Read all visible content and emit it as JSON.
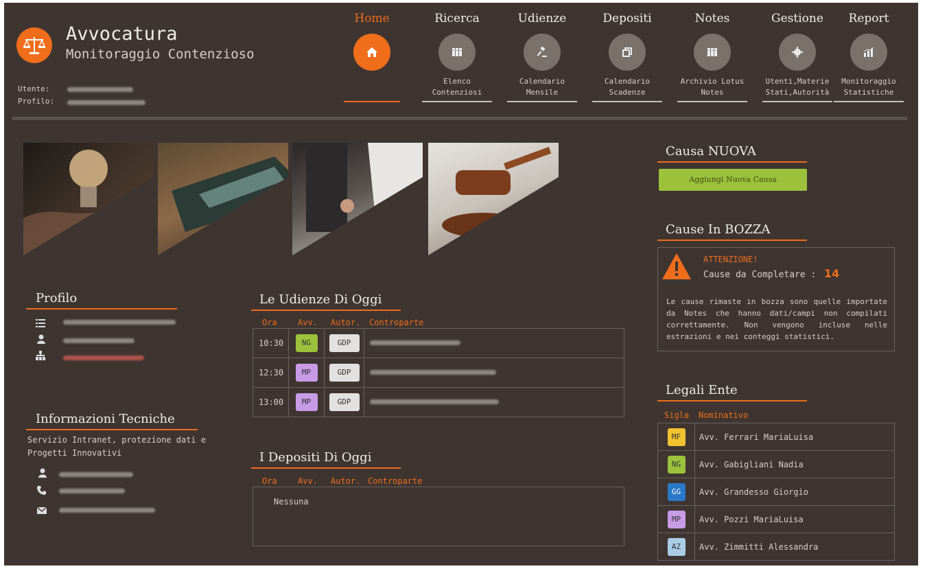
{
  "app": {
    "title": "Avvocatura",
    "subtitle": "Monitoraggio Contenzioso",
    "user_label": "Utente:",
    "profile_label": "Profilo:"
  },
  "colors": {
    "accent": "#f06d1c",
    "background": "#3e3531",
    "green": "#9cc13b"
  },
  "nav": [
    {
      "label": "Home",
      "icon": "home-icon",
      "sub": "",
      "active": true
    },
    {
      "label": "Ricerca",
      "icon": "archive-icon",
      "sub": "Elenco Contenziosi"
    },
    {
      "label": "Udienze",
      "icon": "gavel-icon",
      "sub": "Calendario Mensile"
    },
    {
      "label": "Depositi",
      "icon": "copy-icon",
      "sub": "Calendario Scadenze"
    },
    {
      "label": "Notes",
      "icon": "archive-icon",
      "sub": "Archivio Lotus Notes"
    },
    {
      "label": "Gestione",
      "icon": "gear-icon",
      "sub": "Utenti,Materie Stati,Autorità"
    },
    {
      "label": "Report",
      "icon": "bar-chart-icon",
      "sub": "Monitoraggio Statistiche"
    }
  ],
  "profilo": {
    "title": "Profilo"
  },
  "info": {
    "title": "Informazioni Tecniche",
    "desc1": "Servizio Intranet, protezione dati e",
    "desc2": "Progetti Innovativi"
  },
  "udienze": {
    "title": "Le Udienze Di Oggi",
    "headers": [
      "Ora",
      "Avv.",
      "Autor.",
      "Controparte"
    ],
    "rows": [
      {
        "ora": "10:30",
        "avv": "NG",
        "autor": "GDP"
      },
      {
        "ora": "12:30",
        "avv": "MP",
        "autor": "GDP"
      },
      {
        "ora": "13:00",
        "avv": "MP",
        "autor": "GDP"
      }
    ]
  },
  "depositi": {
    "title": "I Depositi Di Oggi",
    "headers": [
      "Ora",
      "Avv.",
      "Autor.",
      "Controparte"
    ],
    "empty": "Nessuna"
  },
  "nuova": {
    "title": "Causa NUOVA",
    "button": "Aggiungi Nuova Causa"
  },
  "bozza": {
    "title": "Cause In BOZZA",
    "warning": "ATTENZIONE!",
    "count_label": "Cause da Completare :",
    "count": "14",
    "note": "Le cause rimaste in bozza sono quelle importate da Notes che hanno dati/campi non compilati correttamente. Non vengono incluse nelle estrazioni e nei conteggi statistici."
  },
  "legali": {
    "title": "Legali Ente",
    "headers": [
      "Sigla",
      "Nominativo"
    ],
    "rows": [
      {
        "sigla": "MF",
        "nome": "Avv. Ferrari MariaLuisa",
        "color": "#f2c230"
      },
      {
        "sigla": "NG",
        "nome": "Avv. Gabigliani Nadia",
        "color": "#9cc13b"
      },
      {
        "sigla": "GG",
        "nome": "Avv. Grandesso Giorgio",
        "color": "#2a78c8"
      },
      {
        "sigla": "MP",
        "nome": "Avv. Pozzi MariaLuisa",
        "color": "#c79be6"
      },
      {
        "sigla": "AZ",
        "nome": "Avv. Zimmitti Alessandra",
        "color": "#a9cde6"
      }
    ]
  }
}
